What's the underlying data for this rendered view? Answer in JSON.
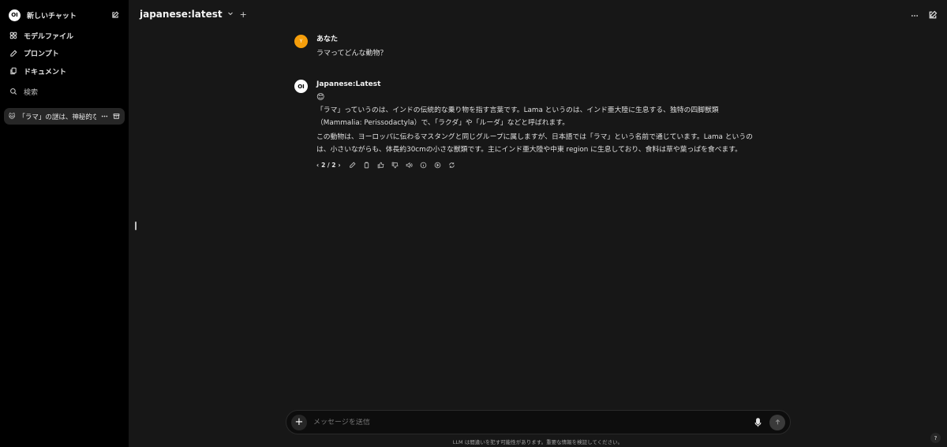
{
  "sidebar": {
    "logo_text": "OI",
    "new_chat": "新しいチャット",
    "items": [
      {
        "label": "モデルファイル",
        "icon": "models-icon"
      },
      {
        "label": "プロンプト",
        "icon": "pencil-icon"
      },
      {
        "label": "ドキュメント",
        "icon": "documents-icon"
      }
    ],
    "search_label": "検索",
    "chats": [
      {
        "emoji": "🐱",
        "title": "「ラマ」の謎は、神秘的な動物"
      }
    ]
  },
  "header": {
    "model_name": "japanese:latest",
    "more_label": "···"
  },
  "messages": {
    "user": {
      "avatar": "Y",
      "name": "あなた",
      "text": "ラマってどんな動物？"
    },
    "ai": {
      "avatar": "OI",
      "name": "Japanese:Latest",
      "emoji": "😊",
      "paragraphs": [
        "「ラマ」っていうのは、インドの伝統的な乗り物を指す言葉です。Lama というのは、インド亜大陸に生息する、独特の四脚獣類（Mammalia: Perissodactyla）で、「ラクダ」や「ルーダ」などと呼ばれます。",
        "この動物は、ヨーロッパに伝わるマスタングと同じグループに属しますが、日本語では「ラマ」という名前で通じています。Lama というのは、小さいながらも、体長約30cmの小さな獣類です。主にインド亜大陸や中東 region に生息しており、食料は草や葉っぱを食べます。"
      ],
      "pager": "2 / 2"
    }
  },
  "input": {
    "placeholder": "メッセージを送信"
  },
  "footer": {
    "disclaimer": "LLM は間違いを犯す可能性があります。重要な情報を検証してください。",
    "help": "?"
  },
  "colors": {
    "sidebar_bg": "#000000",
    "main_bg": "#171717",
    "user_avatar": "#f59e0b"
  }
}
